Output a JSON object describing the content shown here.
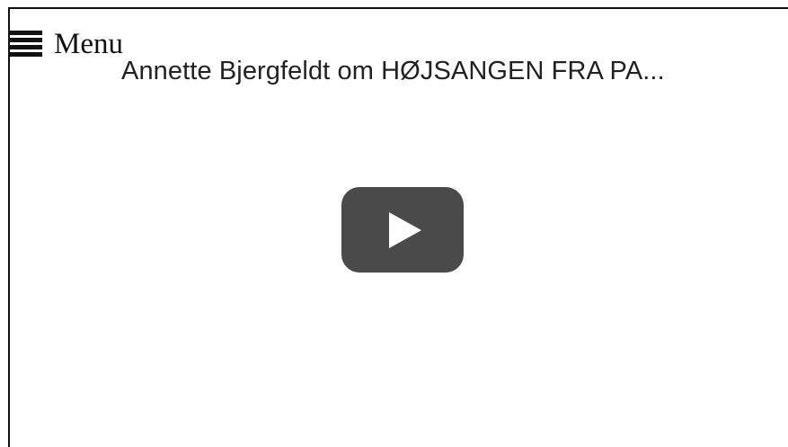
{
  "menu": {
    "label": "Menu",
    "icon": "hamburger-menu-icon"
  },
  "video": {
    "title": "Annette Bjergfeldt om HØJSANGEN FRA PA...",
    "play_icon": "play-icon",
    "play_button_color": "#4a4a4a"
  }
}
